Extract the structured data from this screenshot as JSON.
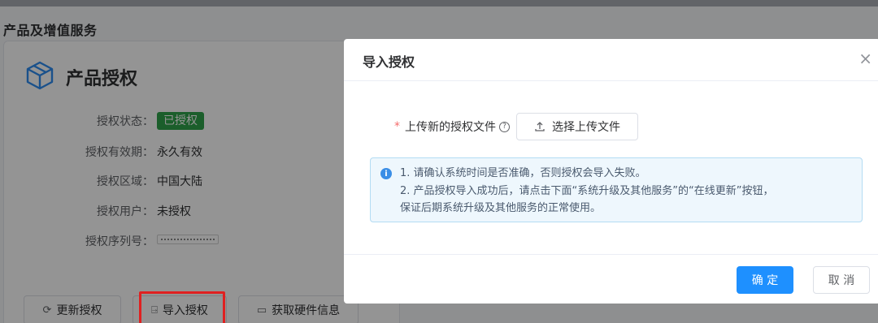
{
  "page": {
    "title": "产品及增值服务"
  },
  "card": {
    "title": "产品授权",
    "icon": "cube-icon",
    "rows": [
      {
        "label": "授权状态：",
        "value": "已授权"
      },
      {
        "label": "授权有效期：",
        "value": "永久有效"
      },
      {
        "label": "授权区域：",
        "value": "中国大陆"
      },
      {
        "label": "授权用户：",
        "value": "未授权"
      },
      {
        "label": "授权序列号：",
        "value": ""
      }
    ],
    "badge_color": "#2fa34a",
    "buttons": {
      "update": "更新授权",
      "import": "导入授权",
      "hardware": "获取硬件信息"
    }
  },
  "dialog": {
    "title": "导入授权",
    "close": "×",
    "upload_label": "上传新的授权文件",
    "required_mark": "*",
    "help": "?",
    "upload_button": "选择上传文件",
    "alert_icon": "i",
    "alert_lines": [
      "1. 请确认系统时间是否准确，否则授权会导入失败。",
      "2. 产品授权导入成功后，请点击下面“系统升级及其他服务”的“在线更新”按钮，",
      "保证后期系统升级及其他服务的正常使用。"
    ],
    "confirm": "确 定",
    "cancel": "取 消",
    "primary_color": "#1e90ff"
  }
}
